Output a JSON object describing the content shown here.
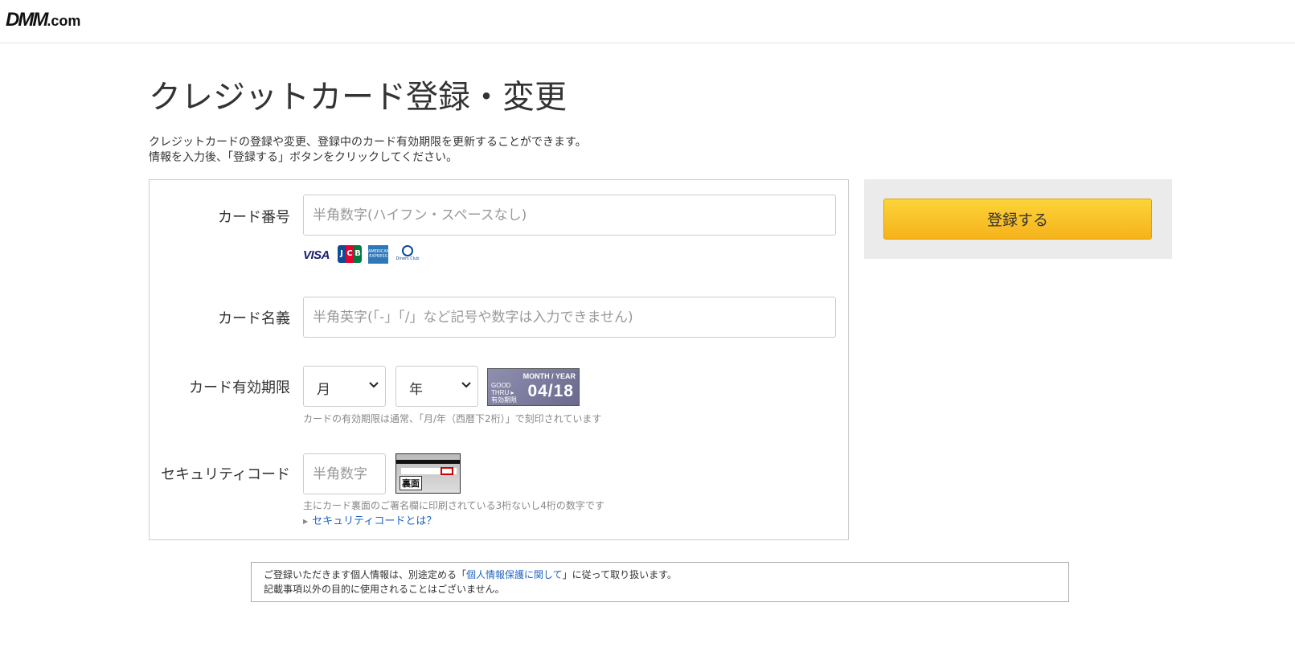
{
  "header": {
    "logo_main": "DMM",
    "logo_suffix": ".com"
  },
  "page": {
    "title": "クレジットカード登録・変更",
    "intro_line1": "クレジットカードの登録や変更、登録中のカード有効期限を更新することができます。",
    "intro_line2": "情報を入力後、「登録する」ボタンをクリックしてください。"
  },
  "form": {
    "card_number": {
      "label": "カード番号",
      "placeholder": "半角数字(ハイフン・スペースなし)",
      "value": ""
    },
    "brands": {
      "visa": "VISA",
      "jcb": [
        "J",
        "C",
        "B"
      ],
      "amex": "AMERICAN EXPRESS",
      "diners": "Diners Club"
    },
    "card_name": {
      "label": "カード名義",
      "placeholder": "半角英字(「-」「/」など記号や数字は入力できません)",
      "value": ""
    },
    "expiry": {
      "label": "カード有効期限",
      "month_selected": "月",
      "year_selected": "年",
      "image": {
        "month_year": "MONTH / YEAR",
        "good_thru": "GOOD",
        "thru": "THRU ▸",
        "jp": "有効期限",
        "date": "04/18"
      },
      "hint": "カードの有効期限は通常、「月/年（西暦下2桁）」で刻印されています"
    },
    "security": {
      "label": "セキュリティコード",
      "placeholder": "半角数字",
      "value": "",
      "card_back_label": "裏面",
      "hint": "主にカード裏面のご署名欄に印刷されている3桁ないし4桁の数字です",
      "link": "セキュリティコードとは？"
    }
  },
  "side": {
    "submit_label": "登録する"
  },
  "privacy": {
    "line1_pre": "ご登録いただきます個人情報は、別途定める「",
    "line1_link": "個人情報保護に関して",
    "line1_post": "」に従って取り扱います。",
    "line2": "記載事項以外の目的に使用されることはございません。"
  },
  "colors": {
    "button_top": "#fcd43a",
    "button_bottom": "#f6b21a",
    "link": "#2066c4",
    "side_bg": "#ebebeb"
  }
}
